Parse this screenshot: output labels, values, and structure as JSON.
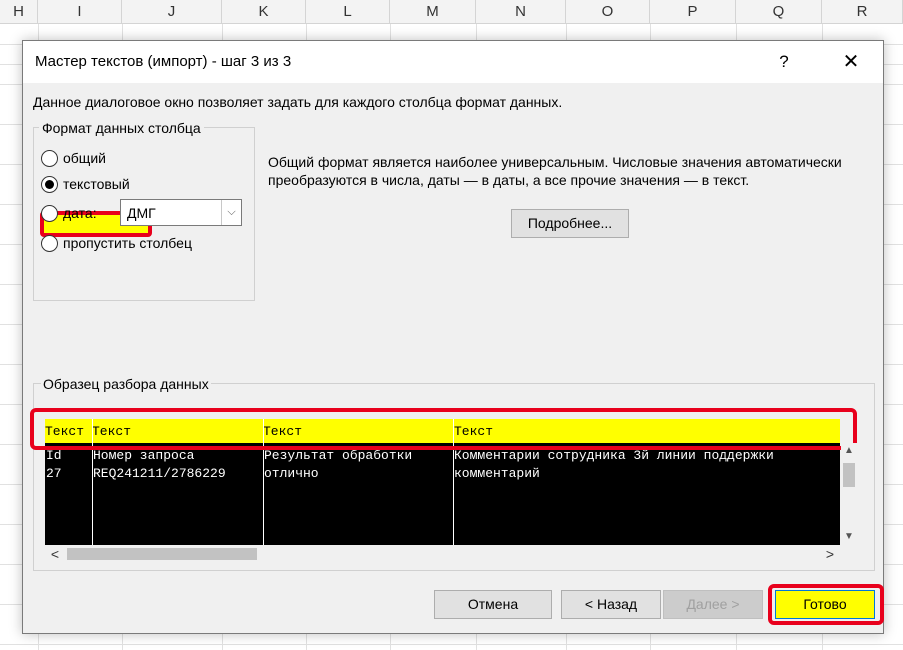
{
  "spreadsheet": {
    "columns": [
      "H",
      "I",
      "J",
      "K",
      "L",
      "M",
      "N",
      "O",
      "P",
      "Q",
      "R"
    ]
  },
  "dialog": {
    "title": "Мастер текстов (импорт) - шаг 3 из 3",
    "help_label": "?",
    "close_label": "✕",
    "description": "Данное диалоговое окно позволяет задать для каждого столбца формат данных.",
    "format_group": {
      "legend": "Формат данных столбца",
      "options": [
        {
          "label": "общий",
          "checked": false
        },
        {
          "label": "текстовый",
          "checked": true
        },
        {
          "label": "дата:",
          "checked": false
        },
        {
          "label": "пропустить столбец",
          "checked": false
        }
      ],
      "date_value": "ДМГ",
      "date_arrow": "⌵"
    },
    "info_text": "Общий формат является наиболее универсальным. Числовые значения автоматически преобразуются в числа, даты — в даты, а все прочие значения — в текст.",
    "more_button": "Подробнее...",
    "preview": {
      "legend": "Образец разбора данных",
      "headers": [
        "Текст",
        "Текст",
        "Текст",
        "Текст"
      ],
      "rows": [
        [
          "Id",
          "Номер запроса",
          "Результат обработки",
          "Комментарии сотрудника 3й линии поддержки"
        ],
        [
          "27",
          "REQ241211/2786229",
          "отлично",
          "комментарий"
        ]
      ]
    },
    "buttons": {
      "cancel": "Отмена",
      "back": "< Назад",
      "next": "Далее >",
      "finish": "Готово"
    },
    "scroll": {
      "up": "▲",
      "down": "▼",
      "left": "<",
      "right": ">"
    }
  },
  "colors": {
    "highlight": "#ffff00",
    "annotation_border": "#e8001c",
    "preview_bg": "#000000"
  }
}
